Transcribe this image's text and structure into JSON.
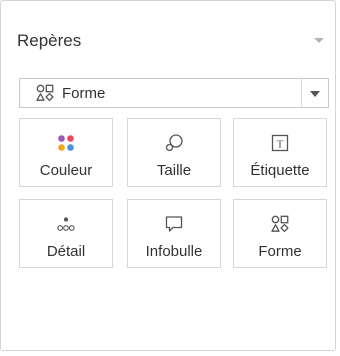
{
  "marks_card": {
    "title": "Repères",
    "mark_type": {
      "selected": "Forme",
      "icon": "shape-icon"
    },
    "properties": [
      {
        "id": "color",
        "label": "Couleur",
        "icon": "color-icon",
        "colors": [
          "#9b59b6",
          "#e74c5c",
          "#f5a623",
          "#4a90d9"
        ]
      },
      {
        "id": "size",
        "label": "Taille",
        "icon": "size-icon"
      },
      {
        "id": "label",
        "label": "Étiquette",
        "icon": "label-icon",
        "glyph": "T"
      },
      {
        "id": "detail",
        "label": "Détail",
        "icon": "detail-icon"
      },
      {
        "id": "tooltip",
        "label": "Infobulle",
        "icon": "tooltip-icon"
      },
      {
        "id": "shape",
        "label": "Forme",
        "icon": "shape-icon"
      }
    ]
  }
}
